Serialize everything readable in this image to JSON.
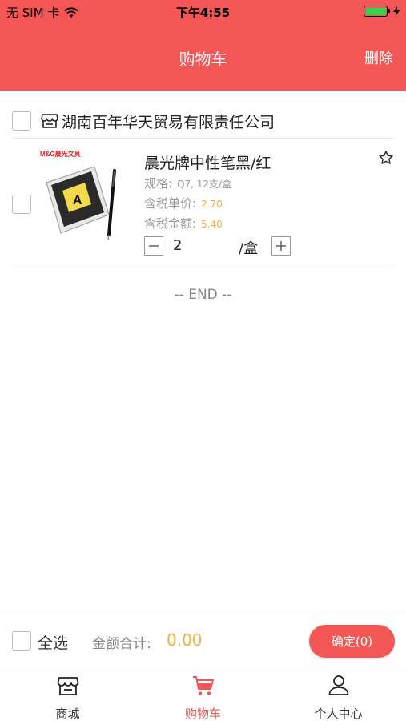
{
  "status_bar": {
    "carrier": "无 SIM 卡",
    "time": "下午4:55"
  },
  "nav": {
    "title": "购物车",
    "delete_label": "删除"
  },
  "store": {
    "name": "湖南百年华天贸易有限责任公司",
    "icon": "store-icon"
  },
  "item": {
    "title": "晨光牌中性笔黑/红",
    "spec_label": "规格:",
    "spec_value": "Q7, 12支/盒",
    "unit_price_label": "含税单价:",
    "unit_price_value": "2.70",
    "total_label": "含税金额:",
    "total_value": "5.40",
    "quantity": "2",
    "unit": "/盒",
    "image_brand": "M&G晨光文具",
    "image_text": "A"
  },
  "end_text": "-- END --",
  "footer": {
    "select_all_label": "全选",
    "total_label": "金额合计:",
    "total_value": "0.00",
    "confirm_label": "确定(0)"
  },
  "tabbar": {
    "items": [
      {
        "label": "商城",
        "icon": "store-icon",
        "active": false
      },
      {
        "label": "购物车",
        "icon": "cart-icon",
        "active": true
      },
      {
        "label": "个人中心",
        "icon": "user-icon",
        "active": false
      }
    ]
  },
  "colors": {
    "accent": "#f45656",
    "price": "#f0b040",
    "muted": "#999999"
  }
}
